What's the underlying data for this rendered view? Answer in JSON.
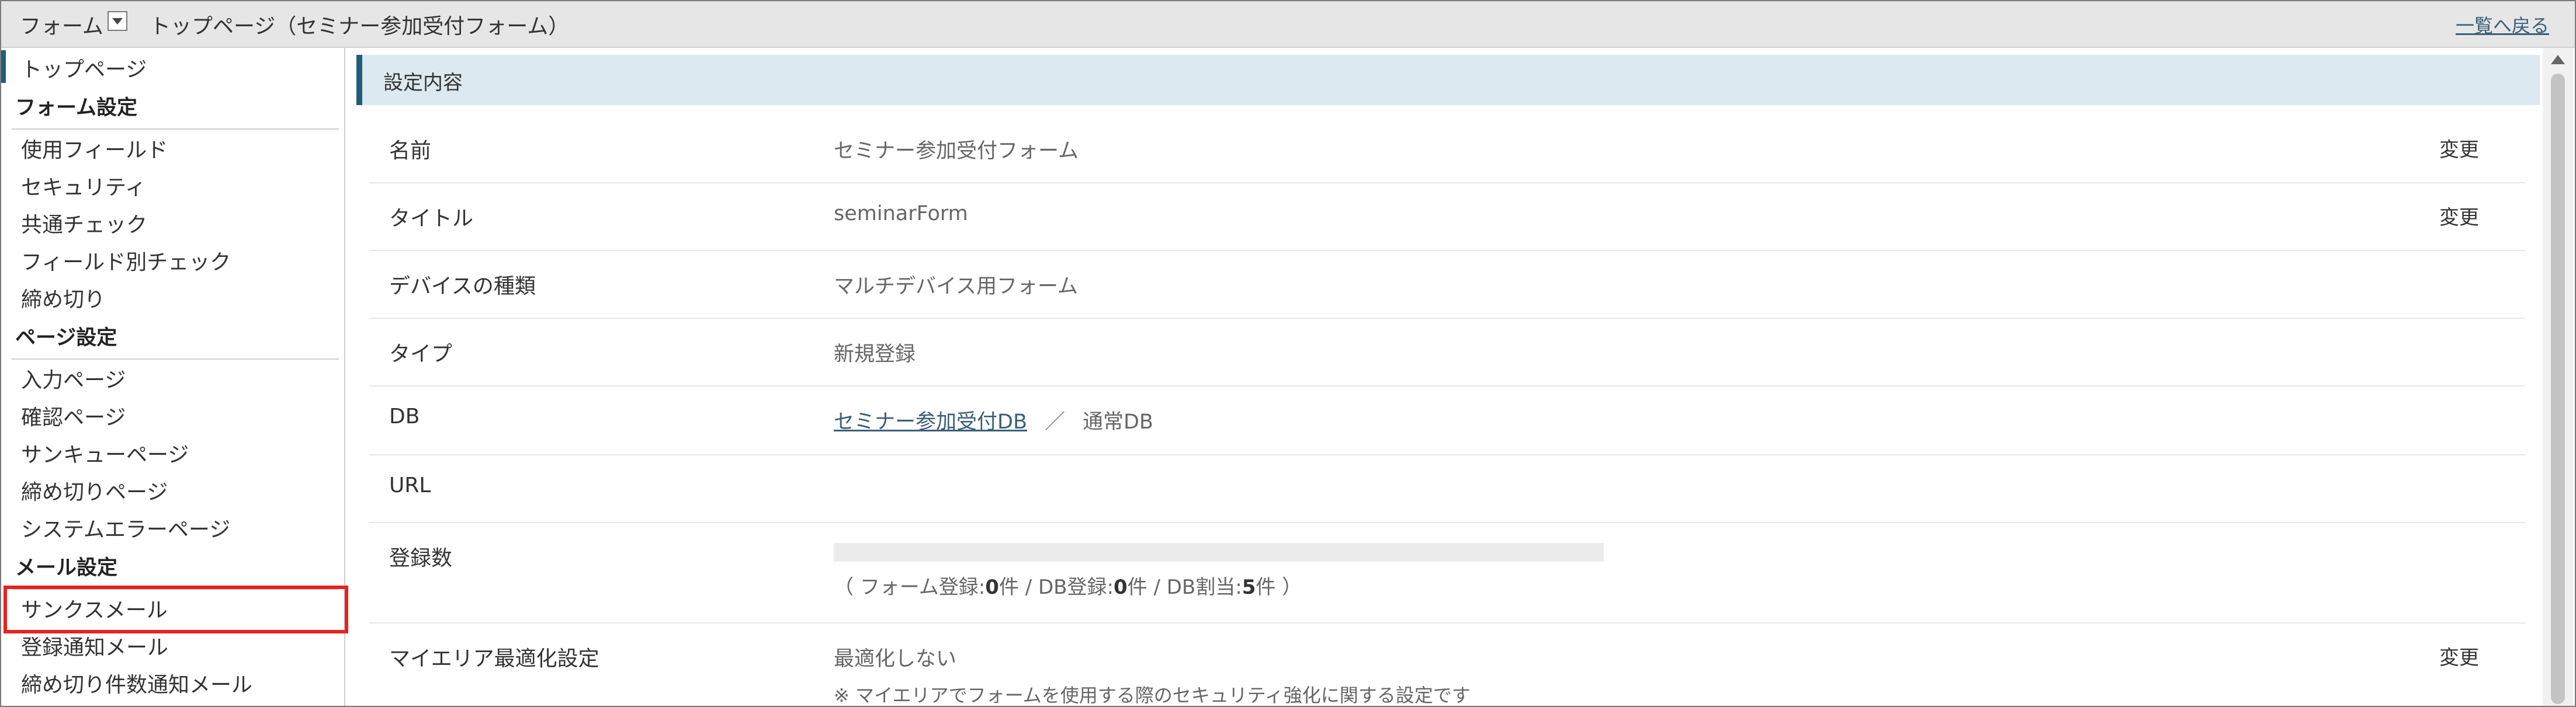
{
  "topbar": {
    "form_label": "フォーム",
    "page_title": "トップページ（セミナー参加受付フォーム）",
    "back_link": "一覧へ戻る"
  },
  "sidebar": {
    "top_item": "トップページ",
    "groups": [
      {
        "heading": "フォーム設定",
        "items": [
          "使用フィールド",
          "セキュリティ",
          "共通チェック",
          "フィールド別チェック",
          "締め切り"
        ]
      },
      {
        "heading": "ページ設定",
        "items": [
          "入力ページ",
          "確認ページ",
          "サンキューページ",
          "締め切りページ",
          "システムエラーページ"
        ]
      },
      {
        "heading": "メール設定",
        "items": [
          "サンクスメール",
          "登録通知メール",
          "締め切り件数通知メール"
        ]
      }
    ]
  },
  "main": {
    "section_title": "設定内容",
    "change_label": "変更",
    "rows": [
      {
        "label": "名前",
        "value": "セミナー参加受付フォーム"
      },
      {
        "label": "タイトル",
        "value": "seminarForm"
      },
      {
        "label": "デバイスの種類",
        "value": "マルチデバイス用フォーム"
      },
      {
        "label": "タイプ",
        "value": "新規登録"
      },
      {
        "label": "DB",
        "db_link": "セミナー参加受付DB",
        "separator": "／",
        "db_type": "通常DB"
      },
      {
        "label": "URL",
        "value": ""
      },
      {
        "label": "登録数",
        "progress_fraction": 0,
        "count": {
          "open": "（",
          "form_label": "フォーム登録:",
          "form_count": "0",
          "unit": "件",
          "sep": " / ",
          "db_label": "DB登録:",
          "db_count": "0",
          "alloc_label": "DB割当:",
          "alloc_count": "5",
          "close": "）"
        }
      },
      {
        "label": "マイエリア最適化設定",
        "value": "最適化しない",
        "note": "※ マイエリアでフォームを使用する際のセキュリティ強化に関する設定です"
      }
    ]
  },
  "colors": {
    "accent": "#1f5d7a",
    "highlight": "#e5231f",
    "header_bg": "#dce9f1",
    "link": "#3a5f78"
  }
}
